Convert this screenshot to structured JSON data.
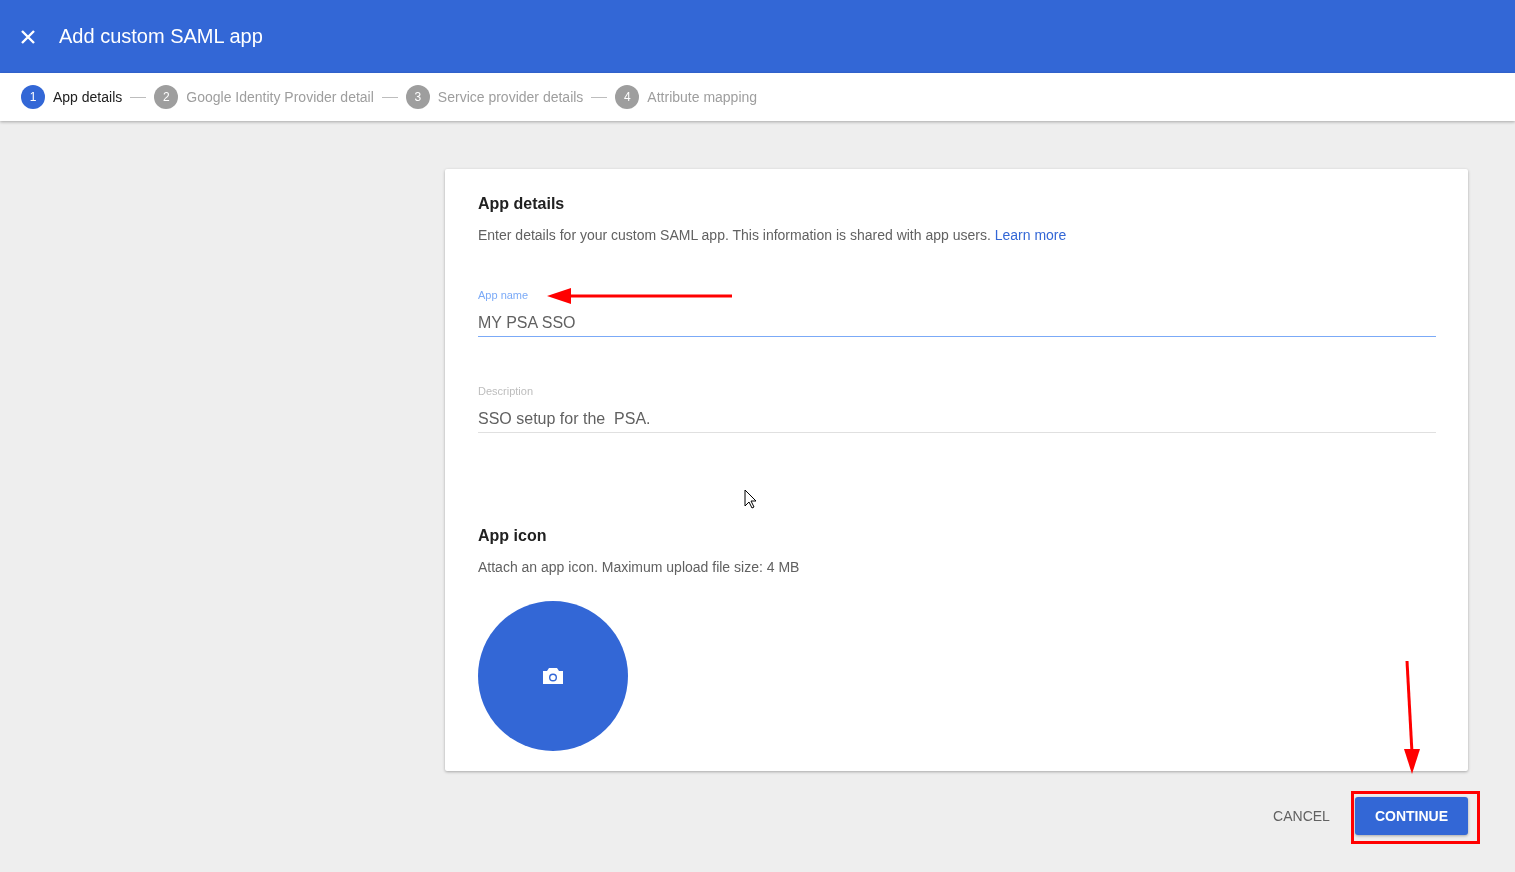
{
  "header": {
    "title": "Add custom SAML app"
  },
  "steps": [
    {
      "number": "1",
      "label": "App details",
      "selected": true
    },
    {
      "number": "2",
      "label": "Google Identity Provider detail",
      "selected": false
    },
    {
      "number": "3",
      "label": "Service provider details",
      "selected": false
    },
    {
      "number": "4",
      "label": "Attribute mapping",
      "selected": false
    }
  ],
  "card": {
    "title": "App details",
    "description": "Enter details for your custom SAML app. This information is shared with app users.",
    "link": "Learn more",
    "fields": [
      {
        "label": "App name",
        "value": "MY PSA SSO",
        "focused": true
      },
      {
        "label": "Description",
        "value": "SSO setup for the  PSA.",
        "focused": false
      }
    ],
    "icon_section": {
      "title": "App icon",
      "description": "Attach an app icon. Maximum upload file size: 4 MB"
    }
  },
  "buttons": [
    {
      "label": "CANCEL",
      "kind": "text"
    },
    {
      "label": "CONTINUE",
      "kind": "primary"
    }
  ]
}
